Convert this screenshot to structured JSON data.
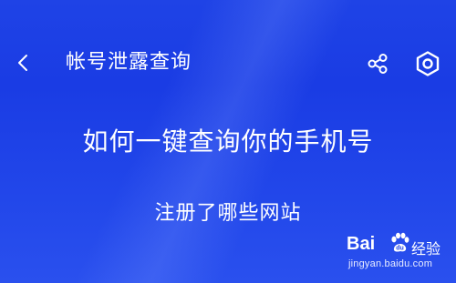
{
  "header": {
    "title": "帐号泄露查询",
    "back_icon": "chevron-left-icon",
    "share_icon": "share-icon",
    "settings_icon": "settings-hexagon-icon"
  },
  "main": {
    "headline": "如何一键查询你的手机号",
    "subline": "注册了哪些网站"
  },
  "watermark": {
    "logo_text": "Bai",
    "paw_icon": "baidu-paw-icon",
    "jingyan_text": "经验",
    "url_text": "jingyan.baidu.com"
  },
  "colors": {
    "background": "#1f43e6",
    "text": "#ffffff"
  }
}
